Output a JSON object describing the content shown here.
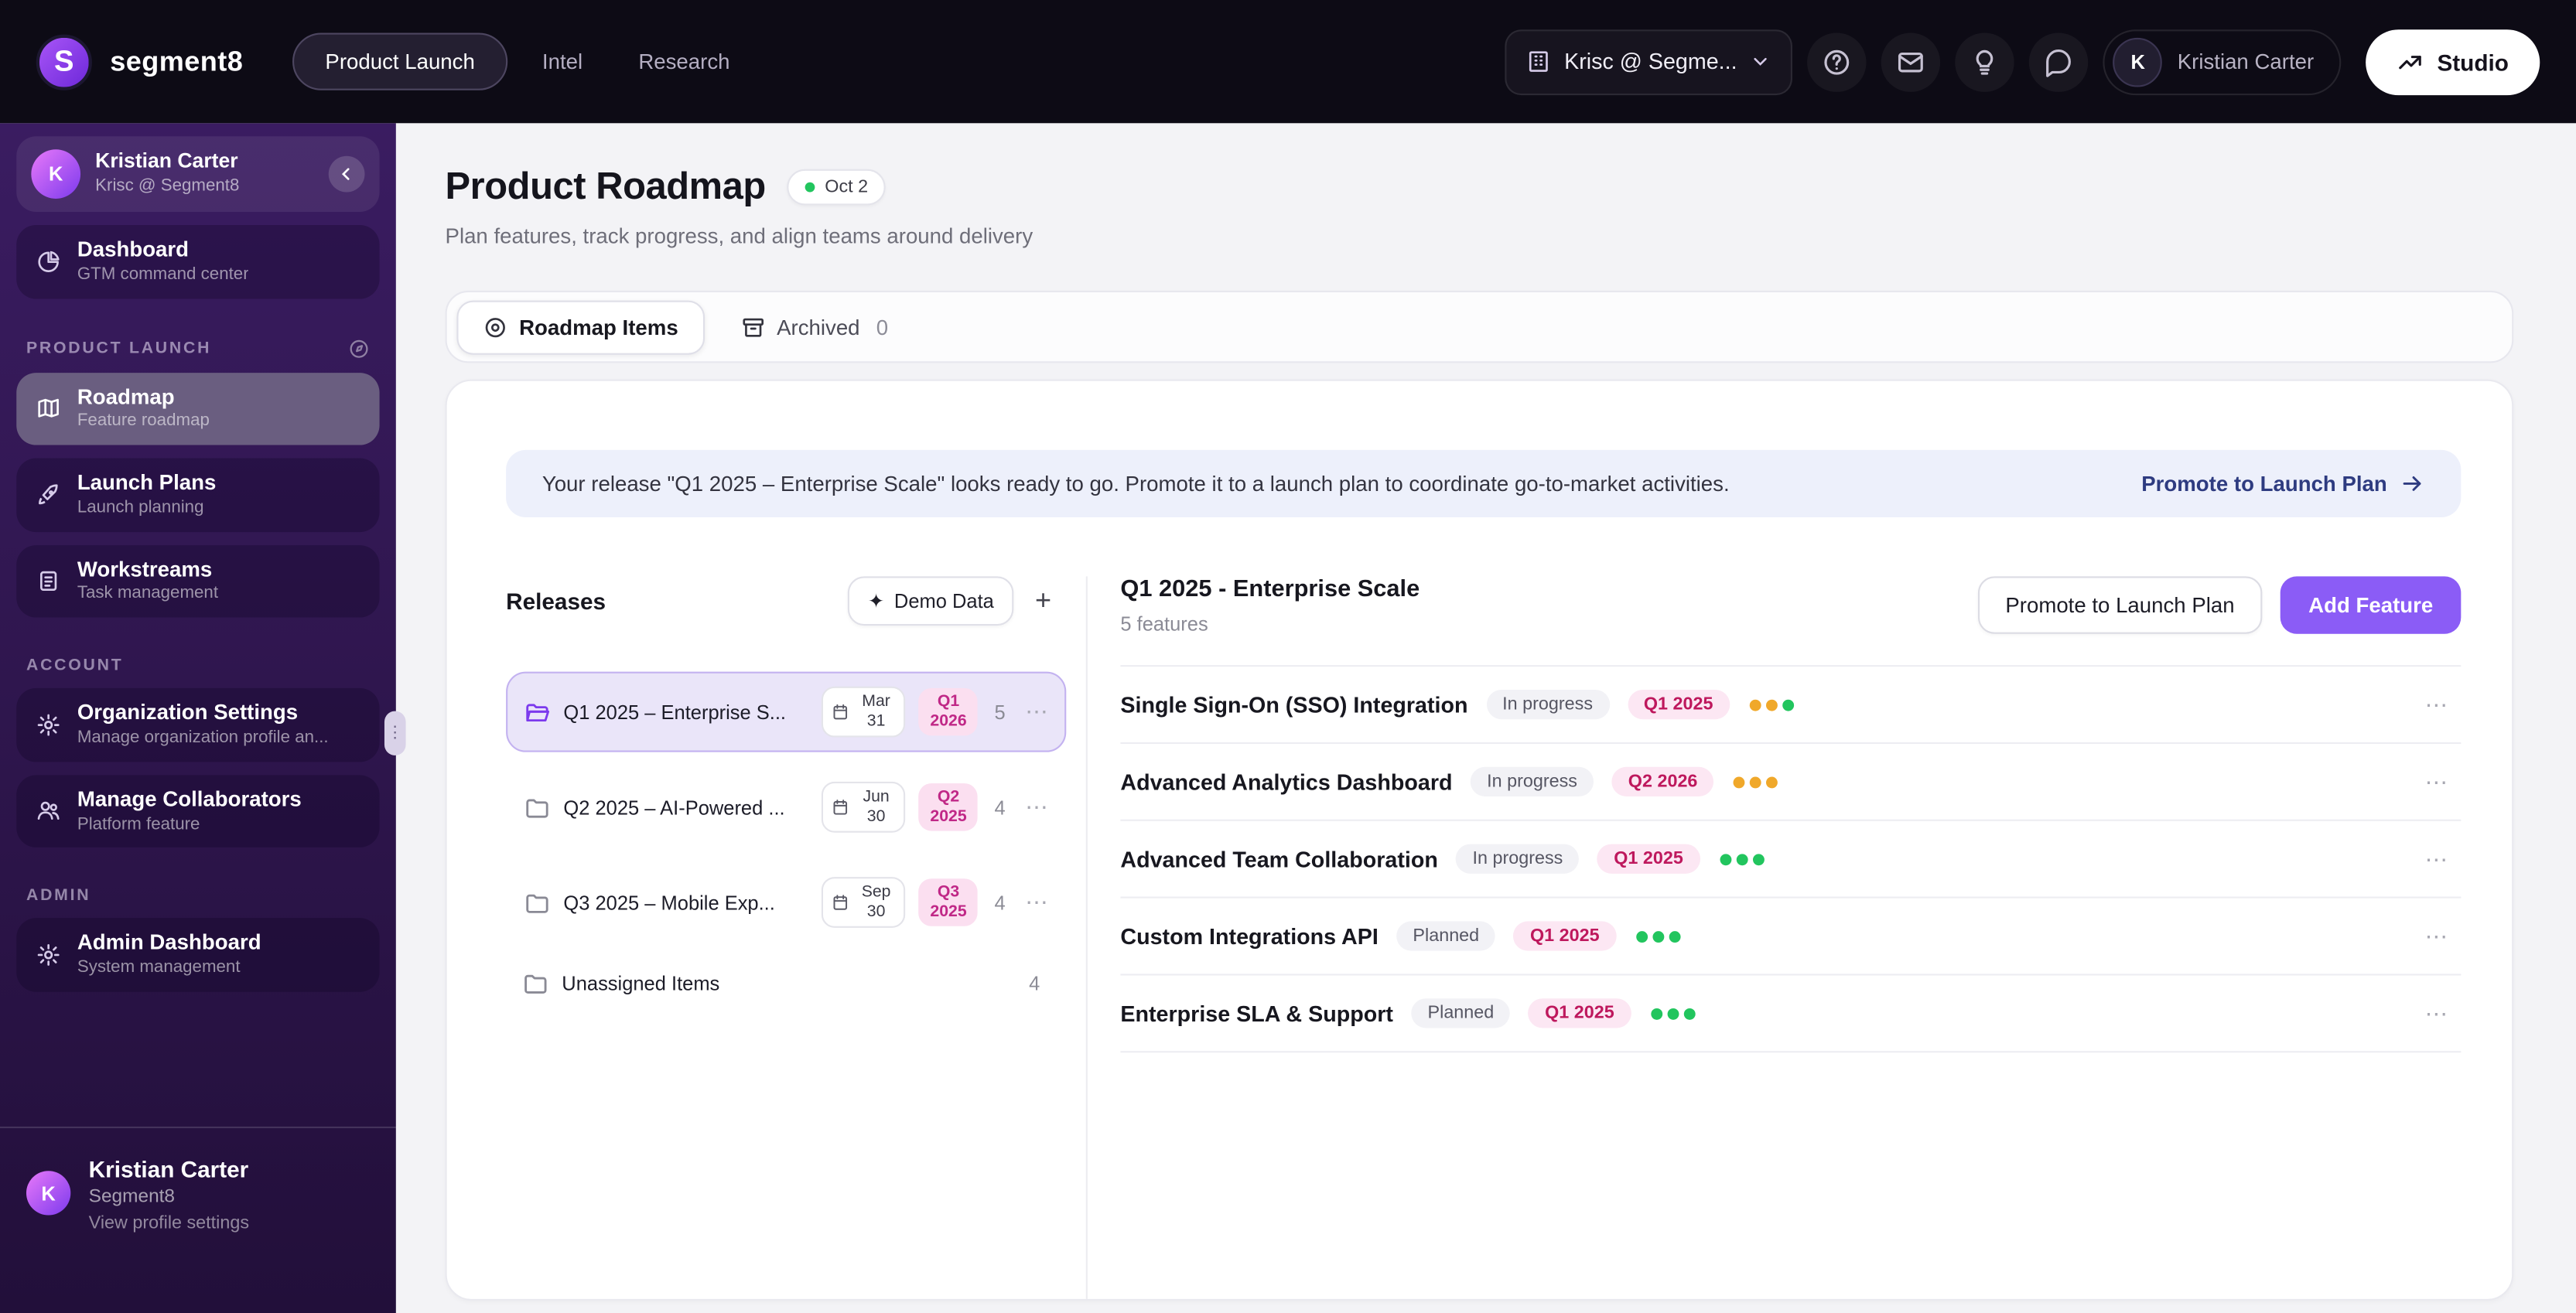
{
  "colors": {
    "amber": "#f0a82a",
    "green": "#22c55e",
    "accent": "#8b5cf6",
    "pink_bg": "#fce7f3",
    "pink_text": "#be185d",
    "topbar_bg": "#0d0b15",
    "sidebar_top": "#3a1c61"
  },
  "icons": {
    "plus": "+",
    "ellipsis": "⋯",
    "sparkle": "✦",
    "grip": "⋮"
  },
  "topbar": {
    "logo_letter": "S",
    "brand": "segment8",
    "nav": [
      {
        "label": "Product Launch"
      },
      {
        "label": "Intel"
      },
      {
        "label": "Research"
      }
    ],
    "org_selector": "Krisc @ Segme...",
    "user": {
      "initial": "K",
      "name": "Kristian Carter"
    },
    "studio_label": "Studio"
  },
  "sidebar": {
    "profile": {
      "initial": "K",
      "name": "Kristian Carter",
      "org": "Krisc @ Segment8"
    },
    "dashboard": {
      "title": "Dashboard",
      "subtitle": "GTM command center"
    },
    "sections": [
      {
        "label": "PRODUCT LAUNCH",
        "items": [
          {
            "title": "Roadmap",
            "subtitle": "Feature roadmap"
          },
          {
            "title": "Launch Plans",
            "subtitle": "Launch planning"
          },
          {
            "title": "Workstreams",
            "subtitle": "Task management"
          }
        ]
      },
      {
        "label": "ACCOUNT",
        "items": [
          {
            "title": "Organization Settings",
            "subtitle": "Manage organization profile an..."
          },
          {
            "title": "Manage Collaborators",
            "subtitle": "Platform feature"
          }
        ]
      },
      {
        "label": "ADMIN",
        "items": [
          {
            "title": "Admin Dashboard",
            "subtitle": "System management"
          }
        ]
      }
    ],
    "footer": {
      "initial": "K",
      "name": "Kristian Carter",
      "org": "Segment8",
      "link": "View profile settings"
    }
  },
  "page": {
    "title": "Product Roadmap",
    "badge": "Oct 2",
    "subtitle": "Plan features, track progress, and align teams around delivery"
  },
  "tabs": {
    "roadmap": "Roadmap Items",
    "archived": "Archived",
    "archived_count": "0"
  },
  "banner": {
    "text": "Your release \"Q1 2025 – Enterprise Scale\" looks ready to go. Promote it to a launch plan to coordinate go-to-market activities.",
    "action": "Promote to Launch Plan"
  },
  "releases": {
    "title": "Releases",
    "demo_button": "Demo Data",
    "items": [
      {
        "name": "Q1 2025 – Enterprise S...",
        "date": "Mar 31",
        "quarter": "Q1 2026",
        "count": "5"
      },
      {
        "name": "Q2 2025 – AI-Powered ...",
        "date": "Jun 30",
        "quarter": "Q2 2025",
        "count": "4"
      },
      {
        "name": "Q3 2025 – Mobile Exp...",
        "date": "Sep 30",
        "quarter": "Q3 2025",
        "count": "4"
      },
      {
        "name": "Unassigned Items",
        "count": "4"
      }
    ]
  },
  "detail": {
    "title": "Q1 2025 - Enterprise Scale",
    "subtitle": "5 features",
    "promote_button": "Promote to Launch Plan",
    "add_button": "Add Feature",
    "features": [
      {
        "name": "Single Sign-On (SSO) Integration",
        "status": "In progress",
        "quarter": "Q1 2025",
        "dots": [
          "amber",
          "amber",
          "green"
        ]
      },
      {
        "name": "Advanced Analytics Dashboard",
        "status": "In progress",
        "quarter": "Q2 2026",
        "dots": [
          "amber",
          "amber",
          "amber"
        ]
      },
      {
        "name": "Advanced Team Collaboration",
        "status": "In progress",
        "quarter": "Q1 2025",
        "dots": [
          "green",
          "green",
          "green"
        ]
      },
      {
        "name": "Custom Integrations API",
        "status": "Planned",
        "quarter": "Q1 2025",
        "dots": [
          "green",
          "green",
          "green"
        ]
      },
      {
        "name": "Enterprise SLA & Support",
        "status": "Planned",
        "quarter": "Q1 2025",
        "dots": [
          "green",
          "green",
          "green"
        ]
      }
    ]
  }
}
